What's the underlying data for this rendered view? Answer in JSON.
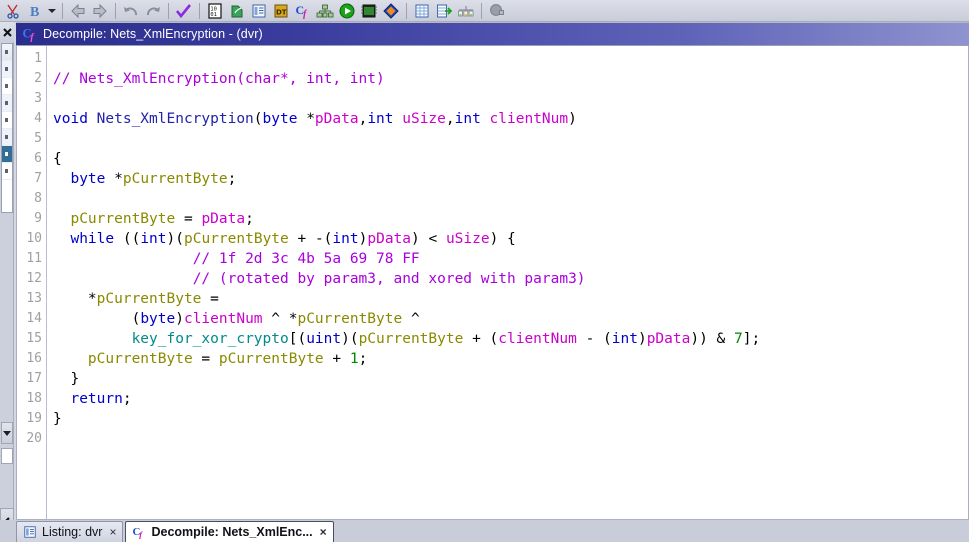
{
  "toolbar": {
    "items": [
      {
        "name": "cut-icon",
        "label": "Cut"
      },
      {
        "name": "bold-b-icon",
        "label": "B"
      },
      {
        "name": "dropdown-caret-icon",
        "label": "More"
      },
      {
        "name": "back-arrow-icon",
        "label": "Back"
      },
      {
        "name": "forward-arrow-icon",
        "label": "Forward"
      },
      {
        "name": "undo-icon",
        "label": "Undo"
      },
      {
        "name": "redo-icon",
        "label": "Redo"
      },
      {
        "name": "checkmark-icon",
        "label": "Check"
      },
      {
        "name": "bytes-viewer-icon",
        "label": "Bytes"
      },
      {
        "name": "export-icon",
        "label": "Export"
      },
      {
        "name": "listing-icon",
        "label": "Listing"
      },
      {
        "name": "data-type-manager-icon",
        "label": "DT"
      },
      {
        "name": "decompiler-icon",
        "label": "Decompile"
      },
      {
        "name": "function-graph-icon",
        "label": "Function Graph"
      },
      {
        "name": "run-icon",
        "label": "Run"
      },
      {
        "name": "memory-map-icon",
        "label": "Memory Map"
      },
      {
        "name": "diamond-icon",
        "label": "Symbol"
      },
      {
        "name": "table-icon",
        "label": "Table"
      },
      {
        "name": "export-table-icon",
        "label": "Export Table"
      },
      {
        "name": "relocation-icon",
        "label": "Relocation"
      },
      {
        "name": "plugin-icon",
        "label": "Plugin"
      }
    ]
  },
  "left_rail": {
    "close_label": "x",
    "expand_label": "<",
    "down_label": "v",
    "minimap_rows": 8,
    "selected_row_index": 6
  },
  "window": {
    "title": "Decompile: Nets_XmlEncryption -  (dvr)",
    "title_icon": "decompiler-icon"
  },
  "code": {
    "line_numbers": [
      "1",
      "2",
      "3",
      "4",
      "5",
      "6",
      "7",
      "8",
      "9",
      "10",
      "11",
      "12",
      "13",
      "14",
      "15",
      "16",
      "17",
      "18",
      "19",
      "20"
    ],
    "lines": [
      {
        "n": 1,
        "tokens": []
      },
      {
        "n": 2,
        "tokens": [
          {
            "t": "// Nets_XmlEncryption(char*, int, int)",
            "c": "cm"
          }
        ]
      },
      {
        "n": 3,
        "tokens": []
      },
      {
        "n": 4,
        "tokens": [
          {
            "t": "void ",
            "c": "k"
          },
          {
            "t": "Nets_XmlEncryption",
            "c": "fn"
          },
          {
            "t": "(",
            "c": "p"
          },
          {
            "t": "byte ",
            "c": "k"
          },
          {
            "t": "*",
            "c": "p"
          },
          {
            "t": "pData",
            "c": "par"
          },
          {
            "t": ",",
            "c": "p"
          },
          {
            "t": "int ",
            "c": "k"
          },
          {
            "t": "uSize",
            "c": "par"
          },
          {
            "t": ",",
            "c": "p"
          },
          {
            "t": "int ",
            "c": "k"
          },
          {
            "t": "clientNum",
            "c": "par"
          },
          {
            "t": ")",
            "c": "p"
          }
        ]
      },
      {
        "n": 5,
        "tokens": []
      },
      {
        "n": 6,
        "tokens": [
          {
            "t": "{",
            "c": "p"
          }
        ]
      },
      {
        "n": 7,
        "tokens": [
          {
            "t": "  ",
            "c": "p"
          },
          {
            "t": "byte ",
            "c": "k"
          },
          {
            "t": "*",
            "c": "p"
          },
          {
            "t": "pCurrentByte",
            "c": "var"
          },
          {
            "t": ";",
            "c": "p"
          }
        ]
      },
      {
        "n": 8,
        "tokens": []
      },
      {
        "n": 9,
        "tokens": [
          {
            "t": "  ",
            "c": "p"
          },
          {
            "t": "pCurrentByte",
            "c": "var"
          },
          {
            "t": " = ",
            "c": "p"
          },
          {
            "t": "pData",
            "c": "par"
          },
          {
            "t": ";",
            "c": "p"
          }
        ]
      },
      {
        "n": 10,
        "tokens": [
          {
            "t": "  ",
            "c": "p"
          },
          {
            "t": "while",
            "c": "k"
          },
          {
            "t": " ((",
            "c": "p"
          },
          {
            "t": "int",
            "c": "k"
          },
          {
            "t": ")(",
            "c": "p"
          },
          {
            "t": "pCurrentByte",
            "c": "var"
          },
          {
            "t": " + -(",
            "c": "p"
          },
          {
            "t": "int",
            "c": "k"
          },
          {
            "t": ")",
            "c": "p"
          },
          {
            "t": "pData",
            "c": "par"
          },
          {
            "t": ") < ",
            "c": "p"
          },
          {
            "t": "uSize",
            "c": "par"
          },
          {
            "t": ") {",
            "c": "p"
          }
        ]
      },
      {
        "n": 11,
        "tokens": [
          {
            "t": "                ",
            "c": "p"
          },
          {
            "t": "// 1f 2d 3c 4b 5a 69 78 FF",
            "c": "cm"
          }
        ]
      },
      {
        "n": 12,
        "tokens": [
          {
            "t": "                ",
            "c": "p"
          },
          {
            "t": "// (rotated by param3, and xored with param3)",
            "c": "cm"
          }
        ]
      },
      {
        "n": 13,
        "tokens": [
          {
            "t": "    *",
            "c": "p"
          },
          {
            "t": "pCurrentByte",
            "c": "var"
          },
          {
            "t": " =",
            "c": "p"
          }
        ]
      },
      {
        "n": 14,
        "tokens": [
          {
            "t": "         (",
            "c": "p"
          },
          {
            "t": "byte",
            "c": "k"
          },
          {
            "t": ")",
            "c": "p"
          },
          {
            "t": "clientNum",
            "c": "par"
          },
          {
            "t": " ^ *",
            "c": "p"
          },
          {
            "t": "pCurrentByte",
            "c": "var"
          },
          {
            "t": " ^",
            "c": "p"
          }
        ]
      },
      {
        "n": 15,
        "tokens": [
          {
            "t": "         ",
            "c": "p"
          },
          {
            "t": "key_for_xor_crypto",
            "c": "gbl"
          },
          {
            "t": "[(",
            "c": "p"
          },
          {
            "t": "uint",
            "c": "k"
          },
          {
            "t": ")(",
            "c": "p"
          },
          {
            "t": "pCurrentByte",
            "c": "var"
          },
          {
            "t": " + (",
            "c": "p"
          },
          {
            "t": "clientNum",
            "c": "par"
          },
          {
            "t": " - (",
            "c": "p"
          },
          {
            "t": "int",
            "c": "k"
          },
          {
            "t": ")",
            "c": "p"
          },
          {
            "t": "pData",
            "c": "par"
          },
          {
            "t": ")) & ",
            "c": "p"
          },
          {
            "t": "7",
            "c": "num"
          },
          {
            "t": "];",
            "c": "p"
          }
        ]
      },
      {
        "n": 16,
        "tokens": [
          {
            "t": "    ",
            "c": "p"
          },
          {
            "t": "pCurrentByte",
            "c": "var"
          },
          {
            "t": " = ",
            "c": "p"
          },
          {
            "t": "pCurrentByte",
            "c": "var"
          },
          {
            "t": " + ",
            "c": "p"
          },
          {
            "t": "1",
            "c": "num"
          },
          {
            "t": ";",
            "c": "p"
          }
        ]
      },
      {
        "n": 17,
        "tokens": [
          {
            "t": "  }",
            "c": "p"
          }
        ]
      },
      {
        "n": 18,
        "tokens": [
          {
            "t": "  ",
            "c": "p"
          },
          {
            "t": "return",
            "c": "k"
          },
          {
            "t": ";",
            "c": "p"
          }
        ]
      },
      {
        "n": 19,
        "tokens": [
          {
            "t": "}",
            "c": "p"
          }
        ]
      },
      {
        "n": 20,
        "tokens": []
      }
    ]
  },
  "tabs": [
    {
      "label": "Listing:  dvr",
      "icon": "listing-icon",
      "close": "×",
      "active": false
    },
    {
      "label": "Decompile: Nets_XmlEnc...",
      "icon": "decompiler-icon",
      "close": "×",
      "active": true
    }
  ],
  "colors": {
    "title_gradient_start": "#2b2d8c",
    "title_gradient_end": "#8f93cf",
    "chrome": "#c9cdd9",
    "comment": "#aa00dd",
    "keyword": "#0000cc",
    "parameter": "#cc00cc",
    "variable": "#8a8a00",
    "global": "#008b8b",
    "constant": "#008800",
    "linenumber": "#a0a0a0",
    "minimap_selected": "#336e99"
  }
}
